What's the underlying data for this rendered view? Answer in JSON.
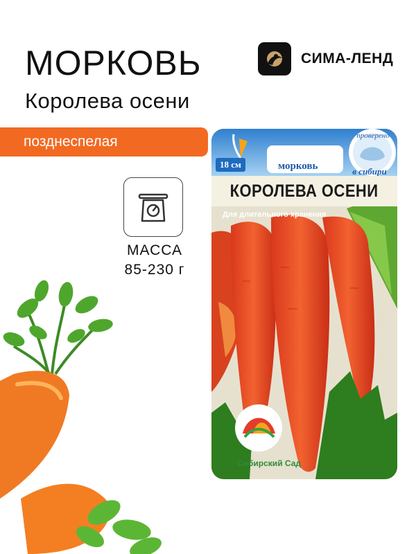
{
  "product": {
    "title": "МОРКОВЬ",
    "subtitle": "Королева осени",
    "ripeness": "позднеспелая",
    "weight_label": "МАССА",
    "weight_value": "85-230 г"
  },
  "brand": {
    "name": "СИМА-ЛЕНД",
    "logo_icon": "sima-land-logo"
  },
  "packet": {
    "length_badge": "18 см",
    "crop_label": "морковь",
    "variety_name": "КОРОЛЕВА ОСЕНИ",
    "note": "Для длительного хранения",
    "stamp_top": "проверено",
    "stamp_bottom": "в сибири",
    "producer": "Сибирский Сад"
  },
  "colors": {
    "accent_orange": "#f26a22",
    "packet_blue": "#1e5ba8",
    "packet_red": "#e4572b"
  }
}
